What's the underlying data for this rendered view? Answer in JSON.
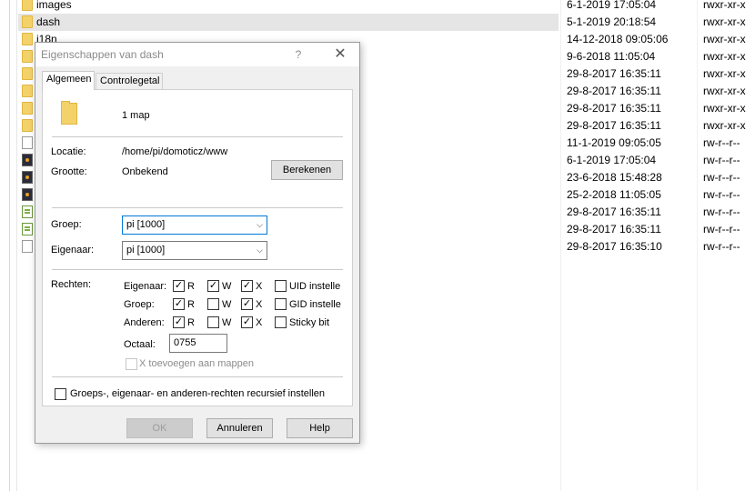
{
  "files": [
    {
      "name": "images",
      "icon": "folder-icon",
      "date": "6-1-2019 17:05:04",
      "perm": "rwxr-xr-x"
    },
    {
      "name": "dash",
      "icon": "folder-icon",
      "date": "5-1-2019 20:18:54",
      "perm": "rwxr-xr-x"
    },
    {
      "name": "i18n",
      "icon": "folder-icon",
      "date": "14-12-2018 09:05:06",
      "perm": "rwxr-xr-x"
    },
    {
      "name": "",
      "icon": "folder-icon",
      "date": "9-6-2018 11:05:04",
      "perm": "rwxr-xr-x"
    },
    {
      "name": "",
      "icon": "folder-icon",
      "date": "29-8-2017 16:35:11",
      "perm": "rwxr-xr-x"
    },
    {
      "name": "",
      "icon": "folder-icon",
      "date": "29-8-2017 16:35:11",
      "perm": "rwxr-xr-x"
    },
    {
      "name": "",
      "icon": "folder-icon",
      "date": "29-8-2017 16:35:11",
      "perm": "rwxr-xr-x"
    },
    {
      "name": "",
      "icon": "folder-icon",
      "date": "29-8-2017 16:35:11",
      "perm": "rwxr-xr-x"
    },
    {
      "name": "",
      "icon": "file-icon",
      "date": "11-1-2019 09:05:05",
      "perm": "rw-r--r--"
    },
    {
      "name": "",
      "icon": "image-file-icon",
      "date": "6-1-2019 17:05:04",
      "perm": "rw-r--r--"
    },
    {
      "name": "",
      "icon": "image-file-icon",
      "date": "23-6-2018 15:48:28",
      "perm": "rw-r--r--"
    },
    {
      "name": "",
      "icon": "image-file-icon",
      "date": "25-2-2018 11:05:05",
      "perm": "rw-r--r--"
    },
    {
      "name": "",
      "icon": "script-file-icon",
      "date": "29-8-2017 16:35:11",
      "perm": "rw-r--r--"
    },
    {
      "name": "",
      "icon": "script-file-icon",
      "date": "29-8-2017 16:35:11",
      "perm": "rw-r--r--"
    },
    {
      "name": "",
      "icon": "file-icon",
      "date": "29-8-2017 16:35:10",
      "perm": "rw-r--r--"
    }
  ],
  "dialog": {
    "title": "Eigenschappen van dash",
    "help": "?",
    "close": "✕",
    "tabs": [
      "Algemeen",
      "Controlegetal"
    ],
    "summary": "1 map",
    "location_label": "Locatie:",
    "location_value": "/home/pi/domoticz/www",
    "size_label": "Grootte:",
    "size_value": "Onbekend",
    "calculate": "Berekenen",
    "group_label": "Groep:",
    "group_value": "pi [1000]",
    "owner_label": "Eigenaar:",
    "owner_value": "pi [1000]",
    "rights_label": "Rechten:",
    "rights": [
      {
        "who": "Eigenaar:",
        "r": true,
        "w": true,
        "x": true,
        "special": "UID instelle",
        "special_checked": false
      },
      {
        "who": "Groep:",
        "r": true,
        "w": false,
        "x": true,
        "special": "GID instelle",
        "special_checked": false
      },
      {
        "who": "Anderen:",
        "r": true,
        "w": false,
        "x": true,
        "special": "Sticky bit",
        "special_checked": false
      }
    ],
    "perm_r": "R",
    "perm_w": "W",
    "perm_x": "X",
    "octal_label": "Octaal:",
    "octal_value": "0755",
    "add_x": "X toevoegen aan mappen",
    "recursive": "Groeps-, eigenaar- en anderen-rechten recursief instellen",
    "ok": "OK",
    "cancel": "Annuleren",
    "help_button": "Help",
    "check_mark": "✓",
    "chevron": "⌵"
  }
}
